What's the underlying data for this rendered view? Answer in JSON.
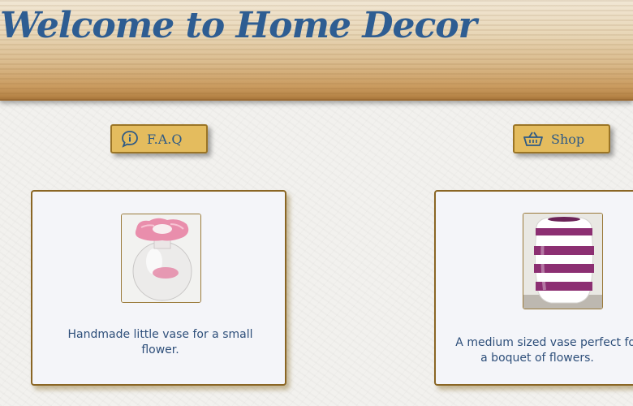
{
  "header": {
    "title": "Welcome to Home Decor"
  },
  "nav": {
    "faq": {
      "label": "F.A.Q",
      "icon": "question-chat-icon"
    },
    "shop": {
      "label": "Shop",
      "icon": "basket-icon"
    }
  },
  "products": [
    {
      "description": "Handmade little vase for a small flower.",
      "image": "pink-glass-vase"
    },
    {
      "description_line1": "A medium sized vase perfect for",
      "description_line2": "a boquet of flowers.",
      "image": "purple-striped-vase"
    }
  ],
  "colors": {
    "title": "#2e5d92",
    "button_bg": "#e4bc5e",
    "button_border": "#9b7526",
    "card_border": "#8a6624",
    "text": "#2e4f7a"
  }
}
